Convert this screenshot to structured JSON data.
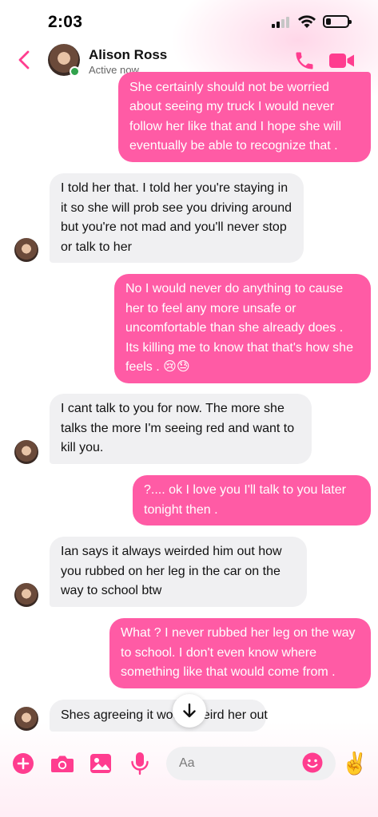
{
  "status_bar": {
    "time": "2:03",
    "battery_level": 0.25
  },
  "header": {
    "contact_name": "Alison Ross",
    "contact_status": "Active now",
    "online": true
  },
  "messages": [
    {
      "direction": "sent",
      "text": "She certainly should not be worried about seeing my truck I would never follow her like that and I hope she will eventually be able to recognize that ."
    },
    {
      "direction": "received",
      "text": "I told her that. I told her you're staying in it so she will prob see you driving around but you're not mad and you'll never stop or talk to her"
    },
    {
      "direction": "sent",
      "text": "No I would never do anything to cause her to feel any more unsafe or uncomfortable than she already does . Its killing me to know that that's how she feels . 😢😓"
    },
    {
      "direction": "received",
      "text": "I cant talk to you for now. The more she talks  the more I'm seeing red and want to kill you."
    },
    {
      "direction": "sent",
      "text": "?.... ok I love you I'll talk to you later tonight then ."
    },
    {
      "direction": "received",
      "text": "Ian says it always weirded him out how you rubbed on her leg in the car on the way to school btw"
    },
    {
      "direction": "sent",
      "text": "What ? I never rubbed her leg on the way to school. I don't even know where something like that would come from ."
    },
    {
      "direction": "received",
      "text": "Shes agreeing it would weird her out"
    }
  ],
  "composer": {
    "placeholder": "Aa",
    "quick_reaction": "✌️"
  },
  "icons": {
    "back": "chevron-left-icon",
    "call": "phone-icon",
    "video": "video-camera-icon",
    "scroll": "arrow-down-icon",
    "plus": "plus-circle-icon",
    "camera": "camera-icon",
    "gallery": "image-icon",
    "mic": "microphone-icon",
    "emoji": "smiley-icon"
  },
  "colors": {
    "accent": "#ff3d8f",
    "sent_bubble": "#ff5ba5",
    "received_bubble": "#f0f0f2",
    "online": "#31a24c"
  }
}
